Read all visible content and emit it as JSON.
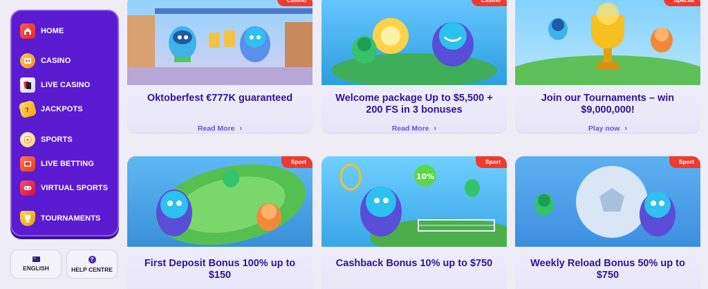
{
  "sidebar": {
    "items": [
      {
        "label": "HOME",
        "icon": "home-icon"
      },
      {
        "label": "CASINO",
        "icon": "slot-machine-icon"
      },
      {
        "label": "LIVE CASINO",
        "icon": "cards-icon"
      },
      {
        "label": "JACKPOTS",
        "icon": "jackpot-ticket-icon"
      },
      {
        "label": "SPORTS",
        "icon": "football-icon"
      },
      {
        "label": "LIVE BETTING",
        "icon": "live-tv-icon"
      },
      {
        "label": "VIRTUAL SPORTS",
        "icon": "virtual-controller-icon"
      },
      {
        "label": "TOURNAMENTS",
        "icon": "trophy-icon"
      }
    ]
  },
  "utility": {
    "language": {
      "label": "ENGLISH",
      "icon": "australia-flag-icon"
    },
    "help": {
      "label": "HELP CENTRE",
      "icon": "help-icon",
      "glyph": "?"
    }
  },
  "cards": [
    {
      "badge": "Casino",
      "title": "Oktoberfest €777K guaranteed",
      "cta": "Read More"
    },
    {
      "badge": "Casino",
      "title": "Welcome package Up to $5,500 + 200 FS in 3 bonuses",
      "cta": "Read More"
    },
    {
      "badge": "Special",
      "title": "Join our Tournaments – win $9,000,000!",
      "cta": "Play now"
    },
    {
      "badge": "Sport",
      "title": "First Deposit Bonus 100% up to $150",
      "cta": ""
    },
    {
      "badge": "Sport",
      "title": "Cashback Bonus 10% up to $750",
      "cta": ""
    },
    {
      "badge": "Sport",
      "title": "Weekly Reload Bonus 50% up to $750",
      "cta": ""
    }
  ],
  "art_text": {
    "cashback_coin": "10%"
  },
  "colors": {
    "sidebar_bg": "#5b1bd0",
    "card_title": "#2f1593",
    "cta": "#6b55c8",
    "badge": "#ee3b2d",
    "page_bg": "#eeedf5"
  }
}
